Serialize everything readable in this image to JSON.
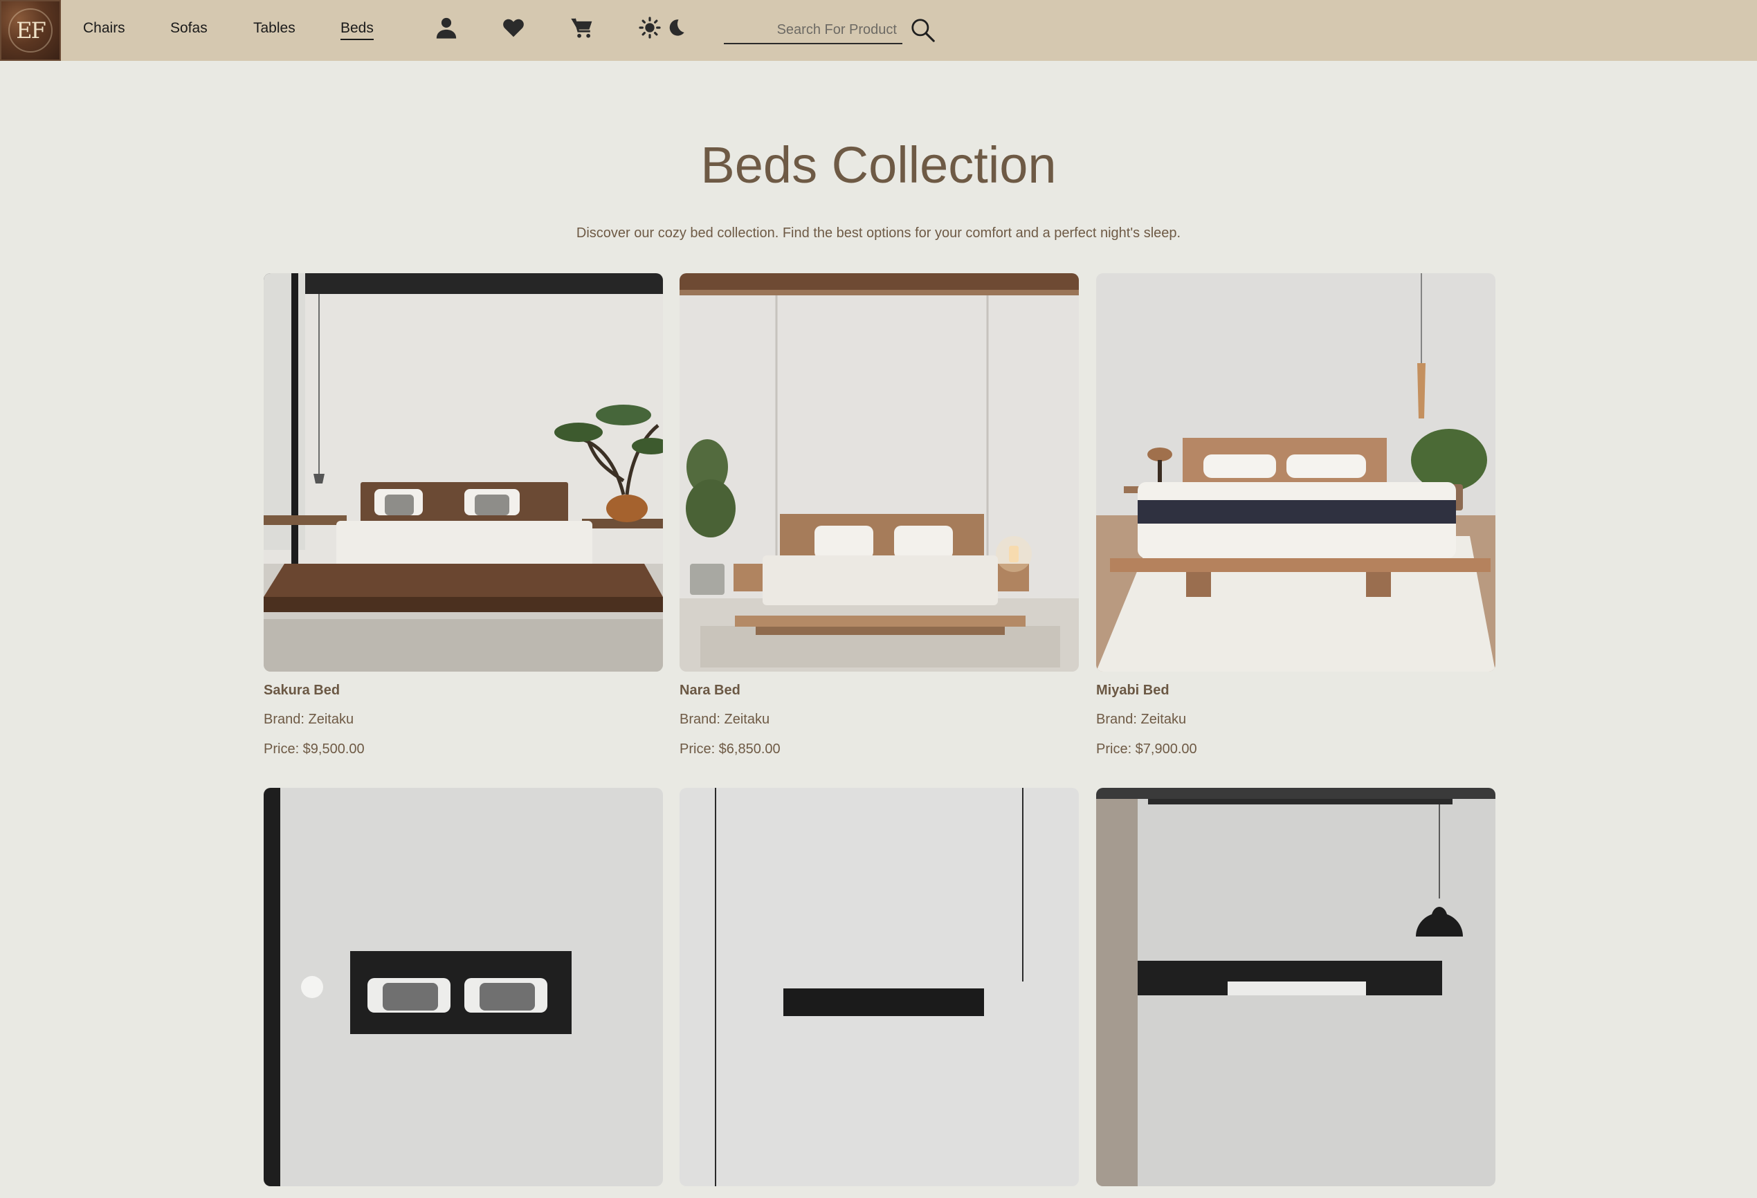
{
  "header": {
    "logo_text": "EF",
    "nav": [
      "Chairs",
      "Sofas",
      "Tables",
      "Beds"
    ],
    "active_nav": "Beds",
    "icons": [
      "user-icon",
      "heart-icon",
      "cart-icon",
      "sun-icon",
      "moon-icon",
      "search-icon"
    ],
    "search": {
      "placeholder": "Search For Product",
      "value": ""
    }
  },
  "main": {
    "title": "Beds Collection",
    "subtitle": "Discover our cozy bed collection. Find the best options for your comfort and a perfect night's sleep.",
    "products": [
      {
        "name": "Sakura Bed",
        "brand": "Brand: Zeitaku",
        "price": "Price: $9,500.00"
      },
      {
        "name": "Nara Bed",
        "brand": "Brand: Zeitaku",
        "price": "Price: $6,850.00"
      },
      {
        "name": "Miyabi Bed",
        "brand": "Brand: Zeitaku",
        "price": "Price: $7,900.00"
      },
      {
        "name": "",
        "brand": "",
        "price": ""
      },
      {
        "name": "",
        "brand": "",
        "price": ""
      },
      {
        "name": "",
        "brand": "",
        "price": ""
      }
    ]
  },
  "colors": {
    "header_bg": "#d5c8b0",
    "page_bg": "#e9e9e3",
    "title_text": "#6e5a45",
    "nav_text": "#1a1a1a"
  }
}
